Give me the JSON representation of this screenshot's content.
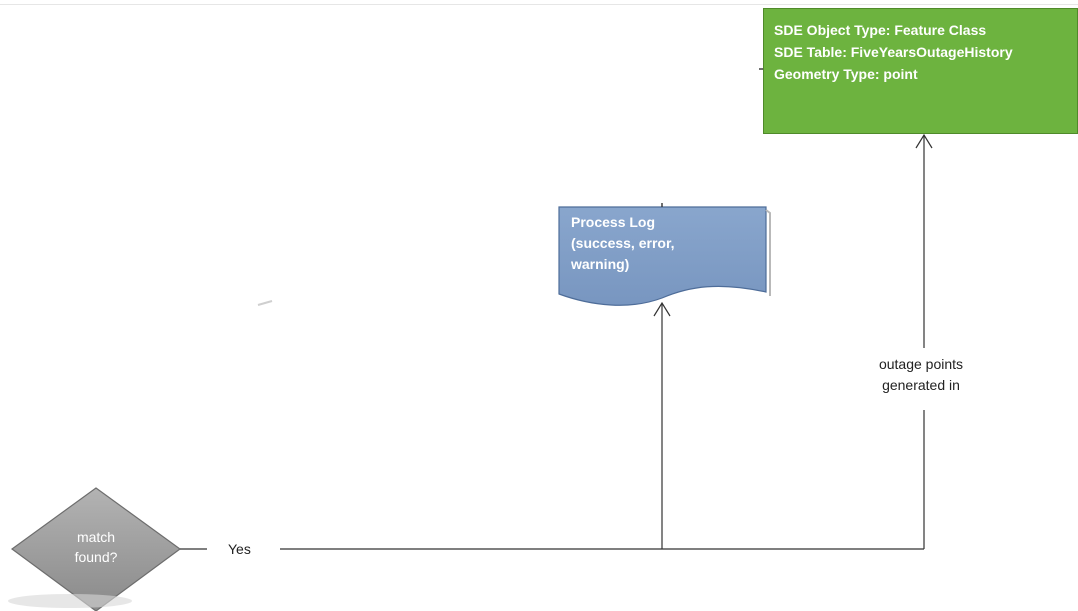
{
  "colors": {
    "process_box": "#6db33f",
    "document_shape": "#7f9dc6",
    "decision_shape": "#9a9a9a",
    "connector": "#333333"
  },
  "nodes": {
    "sde_object": {
      "lines": [
        "SDE Object Type: Feature Class",
        "SDE Table: FiveYearsOutageHistory",
        "Geometry Type: point"
      ]
    },
    "process_log": {
      "lines": [
        "Process Log",
        "(success, error,",
        "warning)"
      ]
    },
    "decision": {
      "lines": [
        "match",
        "found?"
      ]
    }
  },
  "edges": {
    "yes_label": "Yes",
    "outage_label": [
      "outage points",
      "generated in"
    ]
  }
}
